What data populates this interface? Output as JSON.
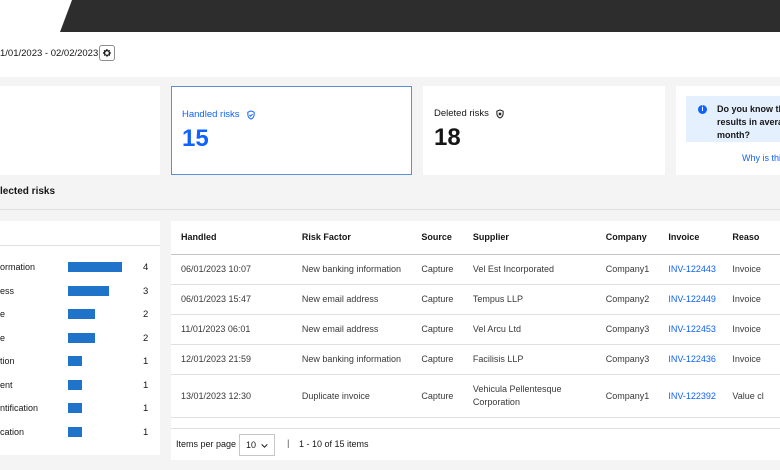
{
  "header": {
    "date_range": "1/01/2023 - 02/02/2023"
  },
  "cards": {
    "handled": {
      "label": "Handled risks",
      "value": "15"
    },
    "deleted": {
      "label": "Deleted risks",
      "value": "18"
    }
  },
  "info": {
    "text_line1": "Do you know th",
    "text_line2": "results in avera",
    "text_line3": "month?",
    "link": "Why is this"
  },
  "section": {
    "title": "lected risks"
  },
  "risk_factors": [
    {
      "label": "ormation",
      "count": "4",
      "level": 4
    },
    {
      "label": "ess",
      "count": "3",
      "level": 3
    },
    {
      "label": "e",
      "count": "2",
      "level": 2
    },
    {
      "label": "e",
      "count": "2",
      "level": 2
    },
    {
      "label": "tion",
      "count": "1",
      "level": 1
    },
    {
      "label": "ent",
      "count": "1",
      "level": 1
    },
    {
      "label": "ntification",
      "count": "1",
      "level": 1
    },
    {
      "label": "cation",
      "count": "1",
      "level": 1
    }
  ],
  "table": {
    "columns": [
      "Handled",
      "Risk Factor",
      "Source",
      "Supplier",
      "Company",
      "Invoice",
      "Reaso"
    ],
    "rows": [
      [
        "06/01/2023 10:07",
        "New banking information",
        "Capture",
        "Vel Est Incorporated",
        "Company1",
        "INV-122443",
        "Invoice"
      ],
      [
        "06/01/2023 15:47",
        "New email address",
        "Capture",
        "Tempus LLP",
        "Company2",
        "INV-122449",
        "Invoice"
      ],
      [
        "11/01/2023 06:01",
        "New email address",
        "Capture",
        "Vel Arcu Ltd",
        "Company3",
        "INV-122453",
        "Invoice"
      ],
      [
        "12/01/2023 21:59",
        "New banking information",
        "Capture",
        "Facilisis LLP",
        "Company3",
        "INV-122436",
        "Invoice"
      ],
      [
        "13/01/2023 12:30",
        "Duplicate invoice",
        "Capture",
        "Vehicula Pellentesque Corporation",
        "Company1",
        "INV-122392",
        "Value cl"
      ]
    ]
  },
  "pager": {
    "label": "Items per page",
    "per_page": "10",
    "separator": "|",
    "range": "1 - 10 of 15 items"
  },
  "colors": {
    "accent": "#0f62fe",
    "bar": "#1f74c9",
    "topbar": "#2d2d2d"
  }
}
